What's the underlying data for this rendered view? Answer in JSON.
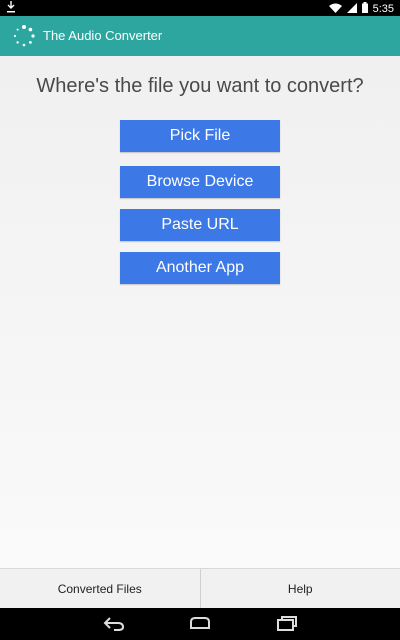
{
  "status_bar": {
    "time": "5:35"
  },
  "app": {
    "title": "The Audio Converter",
    "brand_color": "#2ea6a0"
  },
  "main": {
    "heading": "Where's the file you want to convert?",
    "buttons": [
      {
        "label": "Pick File"
      },
      {
        "label": "Browse Device"
      },
      {
        "label": "Paste URL"
      },
      {
        "label": "Another App"
      }
    ],
    "button_color": "#3c78e6"
  },
  "bottom_bar": {
    "left": "Converted Files",
    "right": "Help"
  },
  "icons": [
    "download-icon",
    "wifi-icon",
    "battery-icon",
    "back-icon",
    "home-icon",
    "recents-icon",
    "app-logo-icon"
  ]
}
